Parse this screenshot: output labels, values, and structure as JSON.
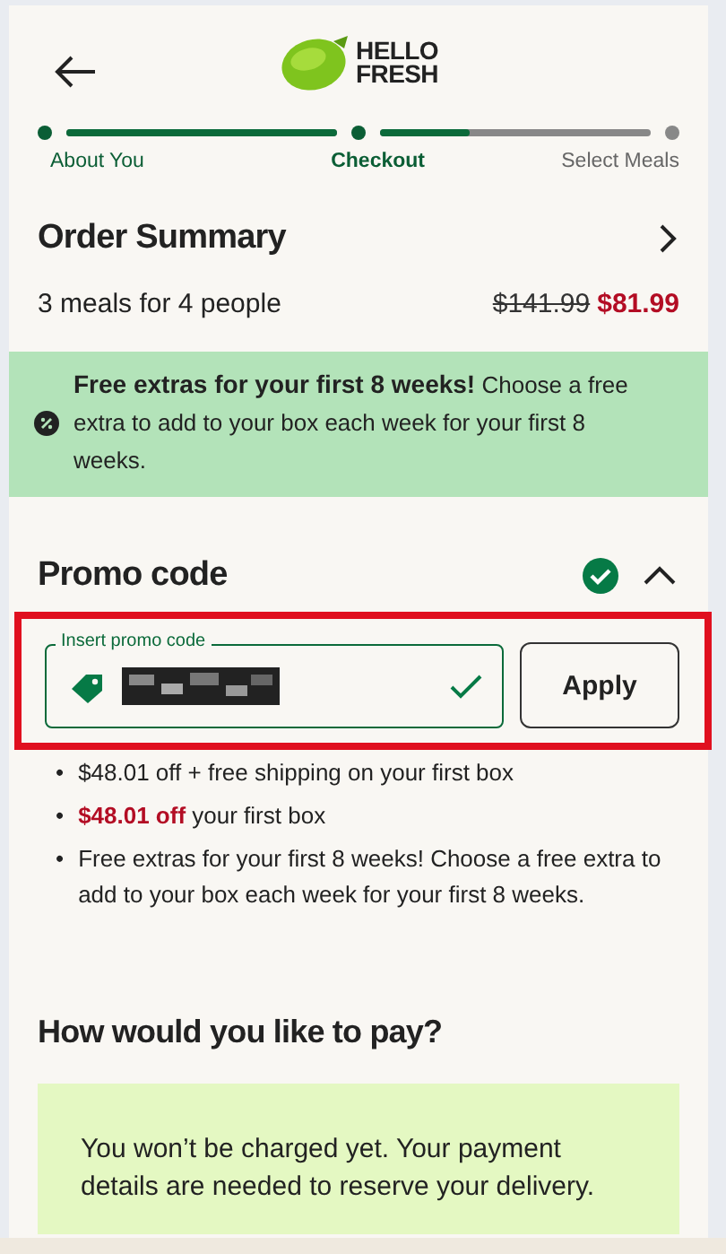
{
  "logo": {
    "text": "HELLO FRESH"
  },
  "stepper": {
    "steps": [
      {
        "label": "About You",
        "completed": true,
        "selected": false
      },
      {
        "label": "Checkout",
        "completed": true,
        "selected": true
      },
      {
        "label": "Select Meals",
        "completed": false,
        "selected": false
      }
    ],
    "segments": [
      {
        "level": 1
      },
      {
        "level": 0.33
      }
    ]
  },
  "order_summary": {
    "title": "Order Summary",
    "items": "3 meals for 4 people",
    "original_price": "$141.99",
    "price": "$81.99"
  },
  "banner": {
    "text": "**Free extras for your first 8 weeks!** Choose a free extra to add to your box each week for your first 8 weeks."
  },
  "promo": {
    "title": "Promo code",
    "applied": true,
    "expanded": true,
    "highlighted": true,
    "field": {
      "label": "Insert promo code",
      "valid": true
    },
    "button": "Apply",
    "benefits": [
      {
        "bullet": "•",
        "text": "$48.01 off + free shipping on your first box"
      },
      {
        "bullet": "•",
        "text": "**$48.01 off** your first box"
      },
      {
        "bullet": "•",
        "text": "Free extras for your first 8 weeks! Choose a free extra to add to your box each week for your first 8 weeks."
      }
    ]
  },
  "payment": {
    "title": "How would you like to pay?",
    "note": "You won’t be charged yet. Your payment details are needed to reserve your delivery."
  }
}
